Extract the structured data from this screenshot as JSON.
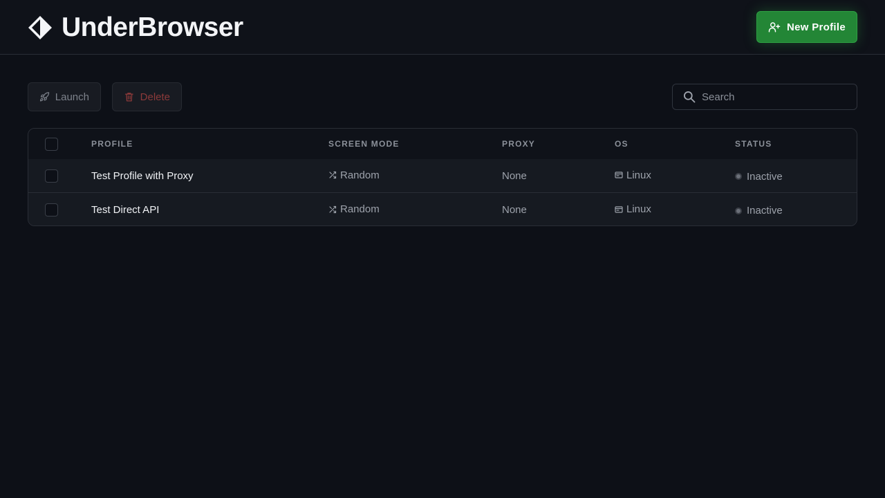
{
  "app": {
    "name": "UnderBrowser"
  },
  "header": {
    "new_profile_label": "New Profile"
  },
  "toolbar": {
    "launch_label": "Launch",
    "delete_label": "Delete",
    "search_placeholder": "Search",
    "search_value": ""
  },
  "table": {
    "columns": {
      "profile": "PROFILE",
      "screen_mode": "SCREEN MODE",
      "proxy": "PROXY",
      "os": "OS",
      "status": "STATUS"
    },
    "rows": [
      {
        "profile": "Test Profile with Proxy",
        "screen_mode": "Random",
        "proxy": "None",
        "os": "Linux",
        "status": "Inactive",
        "checked": false
      },
      {
        "profile": "Test Direct API",
        "screen_mode": "Random",
        "proxy": "None",
        "os": "Linux",
        "status": "Inactive",
        "checked": false
      }
    ]
  },
  "colors": {
    "background": "#0d1017",
    "accent_green": "#238636",
    "danger_text": "#8c3a3a",
    "status_inactive": "#6b7079"
  },
  "icons": {
    "logo": "diamond-logo-icon",
    "new_profile": "user-plus-icon",
    "launch": "rocket-icon",
    "delete": "trash-icon",
    "search": "search-icon",
    "screen_mode": "shuffle-icon",
    "os": "terminal-window-icon",
    "status": "status-dot-icon"
  }
}
